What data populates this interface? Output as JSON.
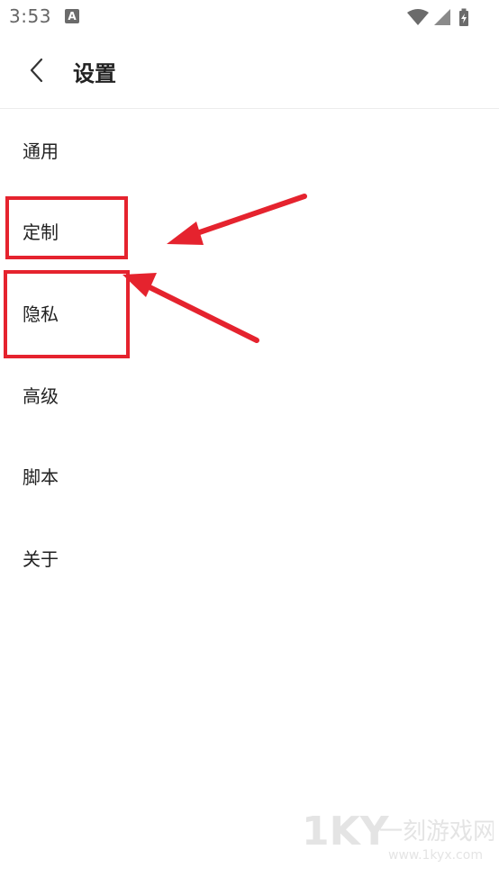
{
  "status_bar": {
    "time": "3:53",
    "notification_icon_letter": "A",
    "icons": [
      "wifi-icon",
      "cell-signal-icon",
      "battery-charging-icon"
    ]
  },
  "header": {
    "back_icon": "chevron-left-icon",
    "title": "设置"
  },
  "menu": {
    "items": [
      {
        "label": "通用"
      },
      {
        "label": "定制"
      },
      {
        "label": "隐私"
      },
      {
        "label": "高级"
      },
      {
        "label": "脚本"
      },
      {
        "label": "关于"
      }
    ]
  },
  "annotation": {
    "color": "#e5232e",
    "highlighted_items": [
      "定制",
      "隐私"
    ]
  },
  "watermark": {
    "logo_text": "1KY",
    "site_name": "一刻游戏网",
    "url": "www.1kyx.com"
  },
  "colors": {
    "background": "#ffffff",
    "text_primary": "#222222",
    "status_text": "#666666",
    "divider": "#ececec"
  }
}
